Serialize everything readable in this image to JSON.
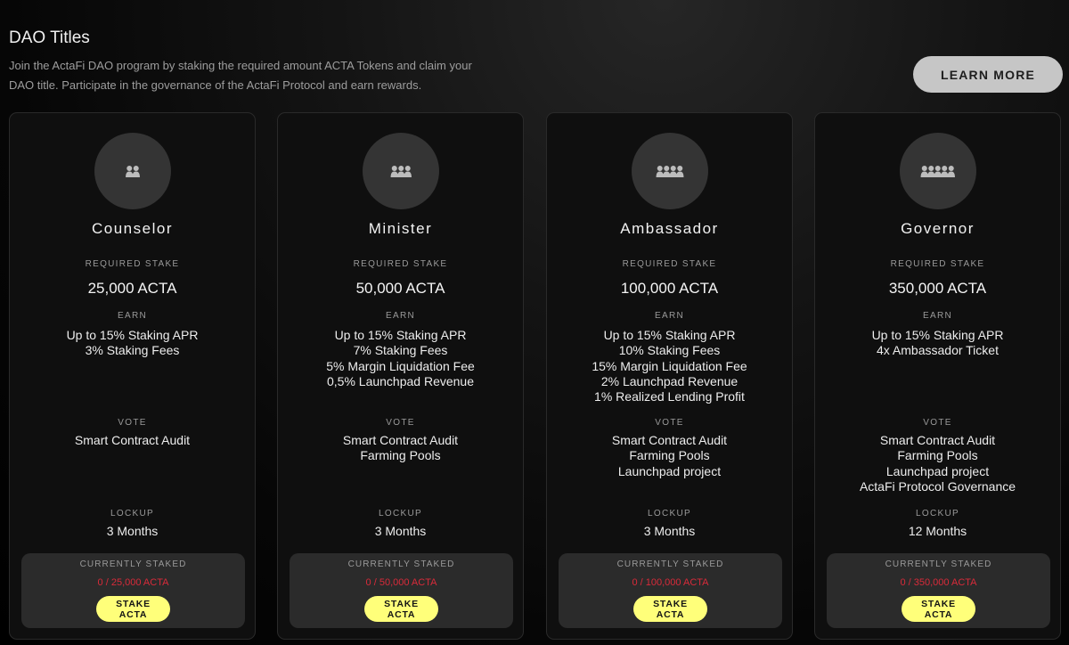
{
  "header": {
    "title": "DAO Titles",
    "description": "Join the ActaFi DAO program by staking the required amount ACTA Tokens and claim your DAO title. Participate in the governance of the ActaFi Protocol and earn rewards.",
    "learn_more_label": "LEARN MORE"
  },
  "labels": {
    "required_stake": "REQUIRED STAKE",
    "earn": "EARN",
    "vote": "VOTE",
    "lockup": "LOCKUP",
    "currently_staked": "CURRENTLY STAKED",
    "stake_button": "STAKE ACTA"
  },
  "colors": {
    "accent_button": "#ffff7a",
    "staked_value": "#d92b3a",
    "learn_more_button": "#c6c6c6"
  },
  "cards": [
    {
      "icon": "users-2-icon",
      "title": "Counselor",
      "required_stake": "25,000 ACTA",
      "earn": [
        "Up to 15% Staking APR",
        "3% Staking Fees"
      ],
      "vote": [
        "Smart Contract Audit"
      ],
      "lockup": "3 Months",
      "currently_staked": "0 / 25,000 ACTA"
    },
    {
      "icon": "users-3-icon",
      "title": "Minister",
      "required_stake": "50,000 ACTA",
      "earn": [
        "Up to 15% Staking APR",
        "7% Staking Fees",
        "5% Margin Liquidation Fee",
        "0,5% Launchpad Revenue"
      ],
      "vote": [
        "Smart Contract Audit",
        "Farming Pools"
      ],
      "lockup": "3 Months",
      "currently_staked": "0 / 50,000 ACTA"
    },
    {
      "icon": "users-group-icon",
      "title": "Ambassador",
      "required_stake": "100,000 ACTA",
      "earn": [
        "Up to 15% Staking APR",
        "10% Staking Fees",
        "15% Margin Liquidation Fee",
        "2% Launchpad Revenue",
        "1% Realized Lending Profit"
      ],
      "vote": [
        "Smart Contract Audit",
        "Farming Pools",
        "Launchpad project"
      ],
      "lockup": "3 Months",
      "currently_staked": "0 / 100,000 ACTA"
    },
    {
      "icon": "users-crowd-icon",
      "title": "Governor",
      "required_stake": "350,000 ACTA",
      "earn": [
        "Up to 15% Staking APR",
        "4x Ambassador Ticket"
      ],
      "vote": [
        "Smart Contract Audit",
        "Farming Pools",
        "Launchpad project",
        "ActaFi Protocol Governance"
      ],
      "lockup": "12 Months",
      "currently_staked": "0 / 350,000 ACTA"
    }
  ]
}
